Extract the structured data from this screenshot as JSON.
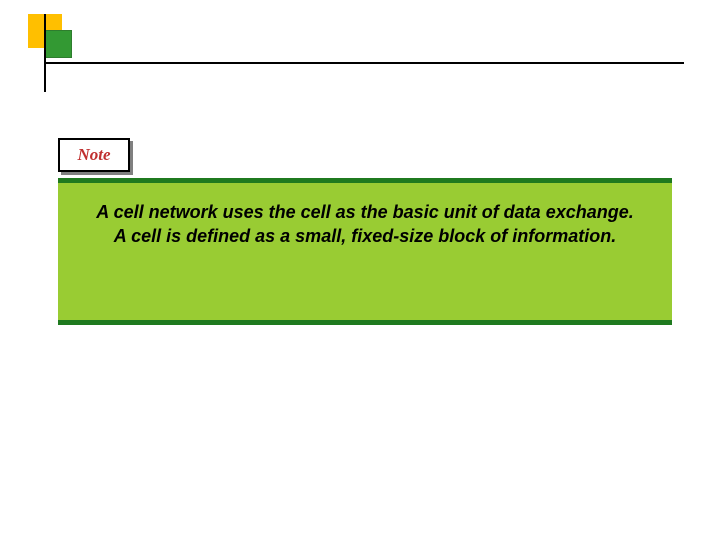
{
  "logo": {
    "outerColor": "#ffbf00",
    "innerColor": "#339933"
  },
  "note": {
    "label": "Note"
  },
  "content": {
    "line1": "A cell network uses the cell as the basic unit of data exchange.",
    "line2": "A cell is defined as a small, fixed-size block of information."
  },
  "colors": {
    "barGreen": "#1f7a1f",
    "panelGreen": "#99CC33",
    "noteRed": "#c03030"
  }
}
